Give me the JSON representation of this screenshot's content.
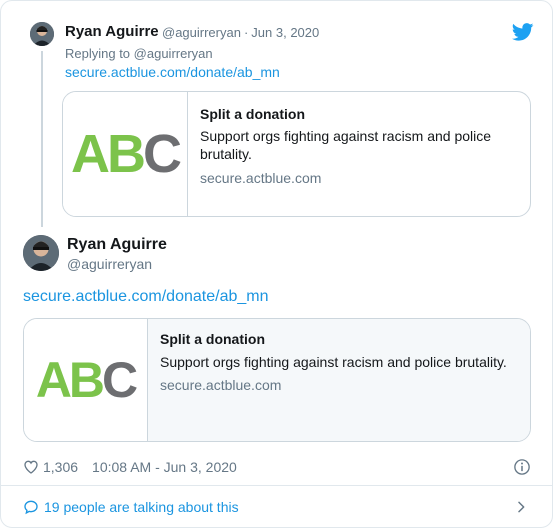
{
  "parent_tweet": {
    "author_name": "Ryan Aguirre",
    "author_handle": "@aguirreryan",
    "separator": "·",
    "date": "Jun 3, 2020",
    "replying_prefix": "Replying to",
    "replying_handle": "@aguirreryan",
    "link": "secure.actblue.com/donate/ab_mn",
    "card": {
      "logo_ab": "AB",
      "logo_c": "C",
      "title": "Split a donation",
      "description": "Support orgs fighting against racism and police brutality.",
      "domain": "secure.actblue.com"
    }
  },
  "main_tweet": {
    "author_name": "Ryan Aguirre",
    "author_handle": "@aguirreryan",
    "link": "secure.actblue.com/donate/ab_mn",
    "card": {
      "logo_ab": "AB",
      "logo_c": "C",
      "title": "Split a donation",
      "description": "Support orgs fighting against racism and police brutality.",
      "domain": "secure.actblue.com"
    },
    "likes": "1,306",
    "timestamp": "10:08 AM - Jun 3, 2020",
    "conversation": "19 people are talking about this"
  },
  "icons": {
    "brand": "twitter-bird-icon",
    "like": "heart-icon",
    "info": "info-icon",
    "conversation": "speech-bubble-icon",
    "expand": "chevron-right-icon"
  },
  "colors": {
    "link": "#1b95e0",
    "twitter_blue": "#1da1f2",
    "secondary_text": "#657786",
    "logo_green": "#7cc34b",
    "logo_gray": "#6d6e71"
  }
}
